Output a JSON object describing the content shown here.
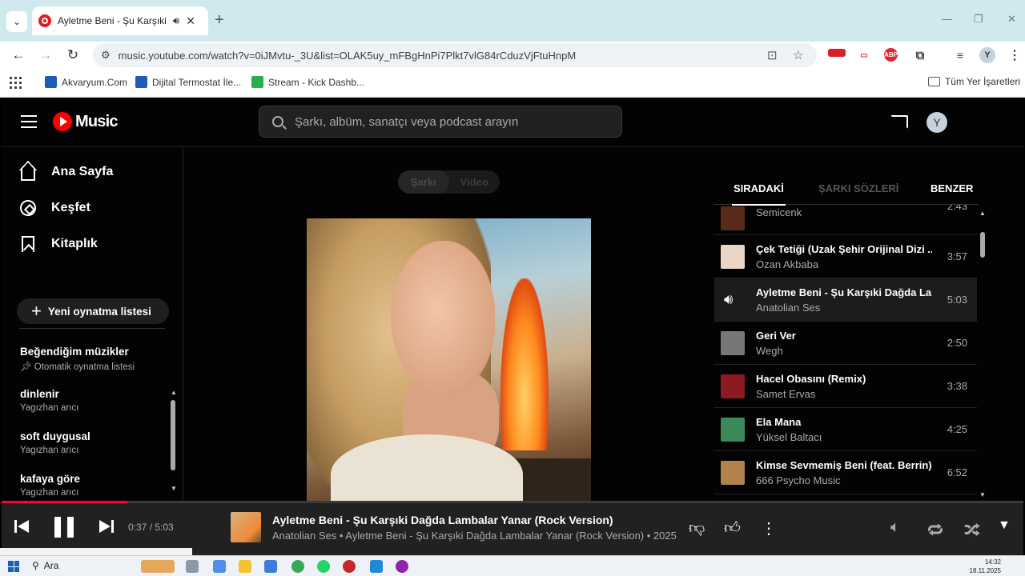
{
  "browser": {
    "tab_title": "Ayletme Beni - Şu Karşıki D...",
    "url": "music.youtube.com/watch?v=0iJMvtu-_3U&list=OLAK5uy_mFBgHnPi7Plkt7vlG84rCduzVjFtuHnpM",
    "ext_badge": "4741",
    "abp_label": "ABP",
    "profile_initial": "Y",
    "bookmarks": [
      "Akvaryum.Com",
      "Dijital Termostat İle...",
      "Stream - Kick Dashb..."
    ],
    "all_bookmarks": "Tüm Yer İşaretleri"
  },
  "ytm": {
    "logo_text": "Music",
    "search_placeholder": "Şarkı, albüm, sanatçı veya podcast arayın",
    "avatar_initial": "Y",
    "nav": [
      "Ana Sayfa",
      "Keşfet",
      "Kitaplık"
    ],
    "new_playlist": "Yeni oynatma listesi",
    "playlists": [
      {
        "title": "Beğendiğim müzikler",
        "sub": "Otomatik oynatma listesi"
      },
      {
        "title": "dinlenir",
        "sub": "Yagızhan arıcı"
      },
      {
        "title": "soft duygusal",
        "sub": "Yagızhan arıcı"
      },
      {
        "title": "kafaya göre",
        "sub": "Yagızhan arıcı"
      }
    ],
    "toggle": [
      "Şarkı",
      "Video"
    ],
    "right_tabs": [
      "SIRADAKİ",
      "ŞARKI SÖZLERİ",
      "BENZER"
    ],
    "queue": [
      {
        "title": "",
        "artist": "Semicenk",
        "duration": "2:43",
        "color": "#5a2a1a"
      },
      {
        "title": "Çek Tetiği (Uzak Şehir Orijinal Dizi ...",
        "artist": "Ozan Akbaba",
        "duration": "3:57",
        "color": "#e9d6c4"
      },
      {
        "title": "Ayletme Beni - Şu Karşıki Dağda La...",
        "artist": "Anatolian Ses",
        "duration": "5:03",
        "color": "#1c1c1c"
      },
      {
        "title": "Geri Ver",
        "artist": "Wegh",
        "duration": "2:50",
        "color": "#777777"
      },
      {
        "title": "Hacel Obasını (Remix)",
        "artist": "Samet Ervas",
        "duration": "3:38",
        "color": "#8b1a22"
      },
      {
        "title": "Ela Mana",
        "artist": "Yüksel Baltacı",
        "duration": "4:25",
        "color": "#3c8a5c"
      },
      {
        "title": "Kimse Sevmemiş Beni (feat. Berrin)",
        "artist": "666 Psycho Music",
        "duration": "6:52",
        "color": "#b0824e"
      }
    ],
    "player": {
      "time": "0:37 / 5:03",
      "progress": 0.123,
      "title": "Ayletme Beni - Şu Karşıki Dağda Lambalar Yanar (Rock Version)",
      "subtitle": "Anatolian Ses • Ayletme Beni - Şu Karşıki Dağda Lambalar Yanar (Rock Version) • 2025"
    }
  },
  "taskbar": {
    "search": "Ara",
    "time": "14:32",
    "date": "18.11.2025"
  },
  "colors": {
    "accent": "#ff0033",
    "ytm_bg": "#030303",
    "player_bg": "#212121"
  }
}
